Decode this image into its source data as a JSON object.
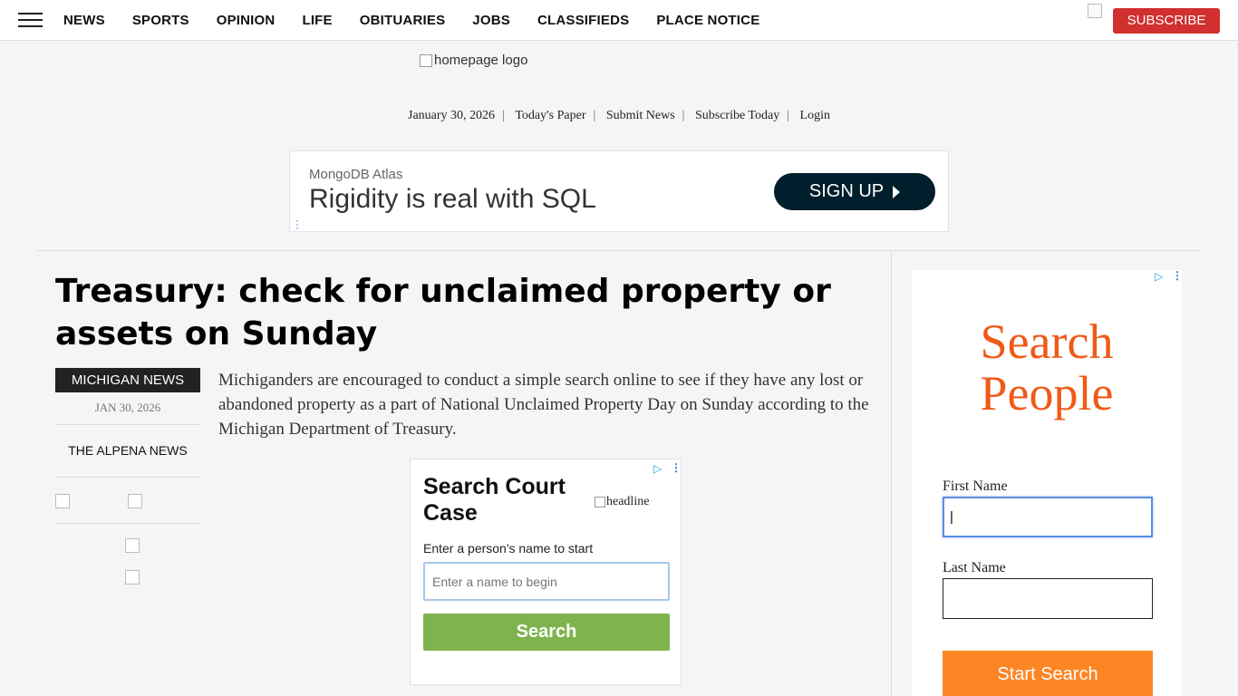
{
  "nav": {
    "items": [
      "NEWS",
      "SPORTS",
      "OPINION",
      "LIFE",
      "OBITUARIES",
      "JOBS",
      "CLASSIFIEDS",
      "PLACE NOTICE"
    ],
    "subscribe_label": "SUBSCRIBE"
  },
  "masthead": {
    "logo_alt": "homepage logo",
    "date": "January 30, 2026",
    "links": [
      "Today's Paper",
      "Submit News",
      "Subscribe Today",
      "Login"
    ]
  },
  "top_ad": {
    "brand": "MongoDB Atlas",
    "headline": "Rigidity is real with SQL",
    "cta": "SIGN UP"
  },
  "article": {
    "title": "Treasury: check for unclaimed property or assets on Sunday",
    "section": "MICHIGAN NEWS",
    "date": "JAN 30, 2026",
    "source": "THE ALPENA NEWS",
    "lede": "Michiganders are encouraged to conduct a simple search online to see if they have any lost or abandoned property as a part of National Unclaimed Property Day on Sunday according to the Michigan Department of Treasury."
  },
  "court_ad": {
    "title": "Search Court Case",
    "image_alt": "headline",
    "prompt": "Enter a person's name to start",
    "placeholder": "Enter a name to begin",
    "button": "Search"
  },
  "people_ad": {
    "title": "Search People",
    "first_name_label": "First Name",
    "last_name_label": "Last Name",
    "button": "Start Search"
  },
  "colors": {
    "subscribe": "#d22f2f",
    "search_people_title": "#ef5a18",
    "court_search_button": "#7fb34d",
    "start_search_button": "#fd8524",
    "signup_button": "#001e2b"
  }
}
